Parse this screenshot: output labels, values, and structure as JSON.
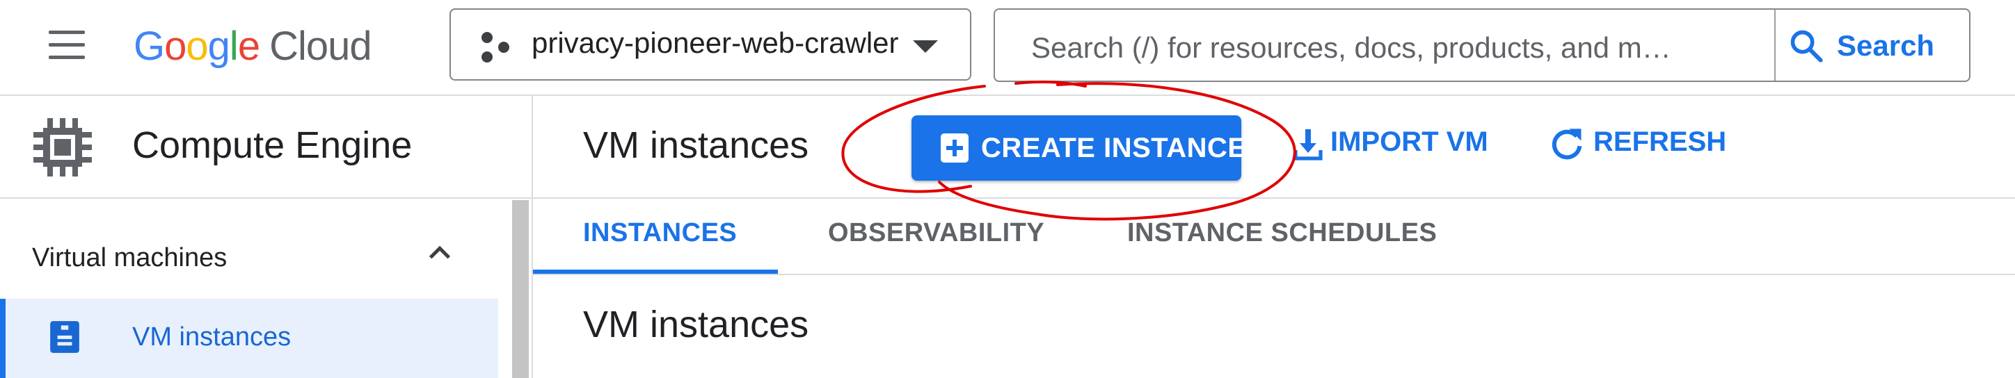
{
  "header": {
    "logo": {
      "google": [
        "G",
        "o",
        "o",
        "g",
        "l",
        "e"
      ],
      "product": "Cloud"
    },
    "project_name": "privacy-pioneer-web-crawler",
    "search": {
      "placeholder": "Search (/) for resources, docs, products, and m…",
      "button_label": "Search"
    }
  },
  "product": {
    "name": "Compute Engine"
  },
  "actionbar": {
    "title": "VM instances",
    "create_label": "CREATE INSTANCE",
    "import_label": "IMPORT VM",
    "refresh_label": "REFRESH"
  },
  "sidebar": {
    "section": "Virtual machines",
    "items": [
      {
        "label": "VM instances",
        "active": true
      }
    ]
  },
  "tabs": [
    {
      "label": "INSTANCES",
      "active": true
    },
    {
      "label": "OBSERVABILITY",
      "active": false
    },
    {
      "label": "INSTANCE SCHEDULES",
      "active": false
    }
  ],
  "main": {
    "section_title": "VM instances"
  },
  "colors": {
    "accent": "#1a73e8",
    "annotation": "#e00000",
    "active_bg": "#e8f0fe"
  },
  "icons": [
    "menu-icon",
    "project-hex-icon",
    "caret-down-icon",
    "search-icon",
    "chip-icon",
    "add-box-icon",
    "download-icon",
    "refresh-icon",
    "chevron-up-icon",
    "vm-icon"
  ]
}
